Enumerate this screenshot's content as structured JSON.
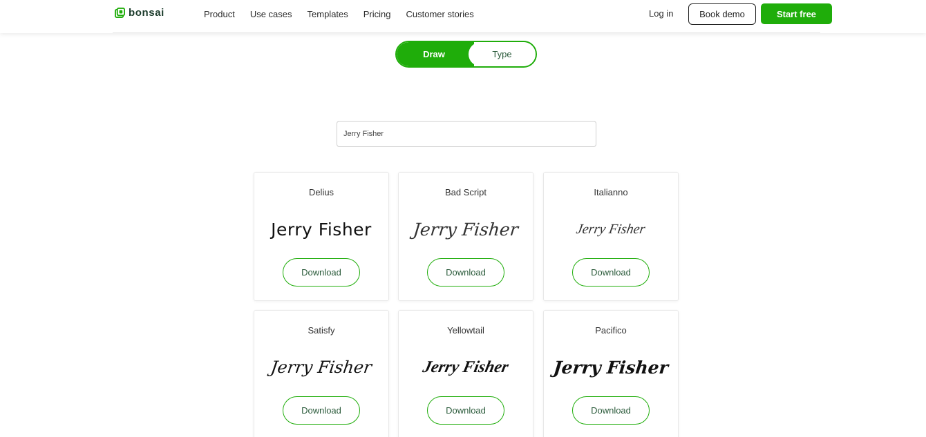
{
  "header": {
    "brand": "bonsai",
    "nav": [
      "Product",
      "Use cases",
      "Templates",
      "Pricing",
      "Customer stories"
    ],
    "login": "Log in",
    "book_demo": "Book demo",
    "start_free": "Start free"
  },
  "toggle": {
    "draw": "Draw",
    "type": "Type",
    "active": "Draw"
  },
  "name_input": {
    "value": "Jerry Fisher"
  },
  "cards": [
    {
      "font": "Delius",
      "sample": "Jerry Fisher",
      "button": "Download"
    },
    {
      "font": "Bad Script",
      "sample": "Jerry Fisher",
      "button": "Download"
    },
    {
      "font": "Italianno",
      "sample": "Jerry Fisher",
      "button": "Download"
    },
    {
      "font": "Satisfy",
      "sample": "Jerry Fisher",
      "button": "Download"
    },
    {
      "font": "Yellowtail",
      "sample": "Jerry Fisher",
      "button": "Download"
    },
    {
      "font": "Pacifico",
      "sample": "Jerry Fisher",
      "button": "Download"
    }
  ],
  "colors": {
    "accent": "#1fad0a",
    "brand_dark": "#1a3a2a"
  },
  "icons": {
    "logo": "bonsai-logo-icon"
  }
}
